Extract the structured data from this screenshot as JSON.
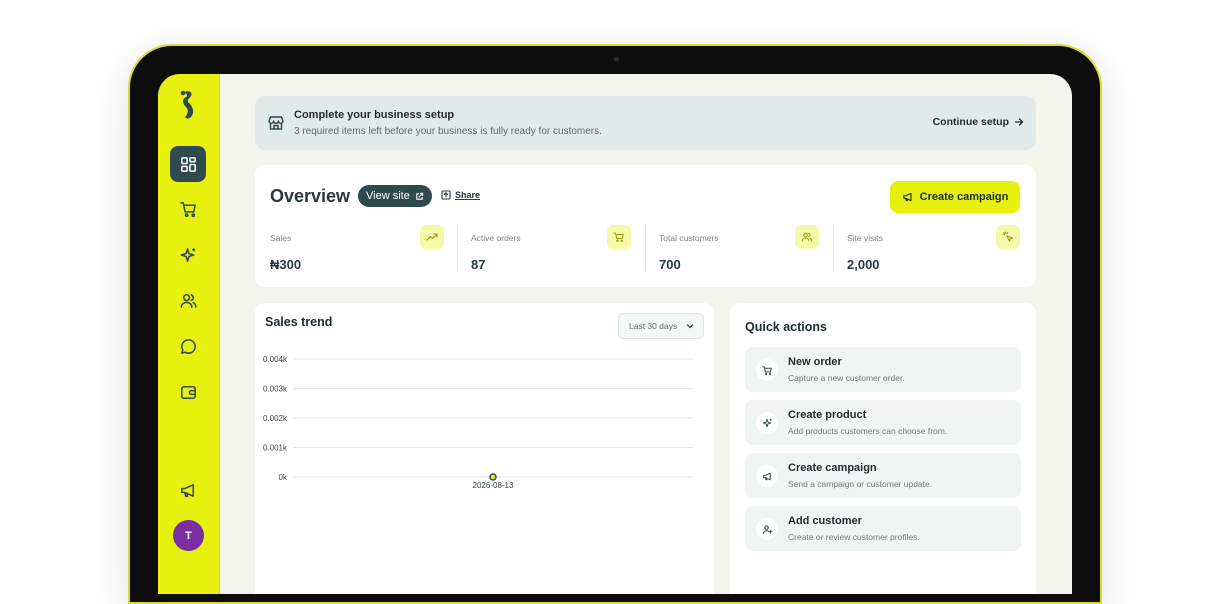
{
  "banner": {
    "title": "Complete your business setup",
    "subtitle": "3 required items left before your business is fully ready for customers.",
    "cta": "Continue setup"
  },
  "overview": {
    "title": "Overview",
    "view_site": "View site",
    "share": "Share",
    "create_campaign": "Create campaign",
    "stats": [
      {
        "label": "Sales",
        "value": "₦300",
        "icon": "trending-up-icon"
      },
      {
        "label": "Active orders",
        "value": "87",
        "icon": "cart-icon"
      },
      {
        "label": "Total customers",
        "value": "700",
        "icon": "users-icon"
      },
      {
        "label": "Site visits",
        "value": "2,000",
        "icon": "pointer-click-icon"
      }
    ]
  },
  "trend": {
    "title": "Sales trend",
    "range": "Last 30 days"
  },
  "chart_data": {
    "type": "line",
    "title": "Sales trend",
    "x": [
      "2026-08-13"
    ],
    "y": [
      0
    ],
    "y_ticks": [
      "0.004k",
      "0.003k",
      "0.002k",
      "0.001k",
      "0k"
    ],
    "ylim": [
      0,
      0.004
    ],
    "grid": true
  },
  "quick_actions": {
    "title": "Quick actions",
    "items": [
      {
        "title": "New order",
        "subtitle": "Capture a new customer order.",
        "icon": "cart-icon"
      },
      {
        "title": "Create product",
        "subtitle": "Add products customers can choose from.",
        "icon": "sparkle-icon"
      },
      {
        "title": "Create campaign",
        "subtitle": "Send a campaign or customer update.",
        "icon": "megaphone-icon"
      },
      {
        "title": "Add customer",
        "subtitle": "Create or review customer profiles.",
        "icon": "user-plus-icon"
      }
    ]
  },
  "user": {
    "initial": "T"
  },
  "colors": {
    "accent": "#e8f00e",
    "dark": "#2f4a4f",
    "avatar": "#7a2ea3"
  }
}
